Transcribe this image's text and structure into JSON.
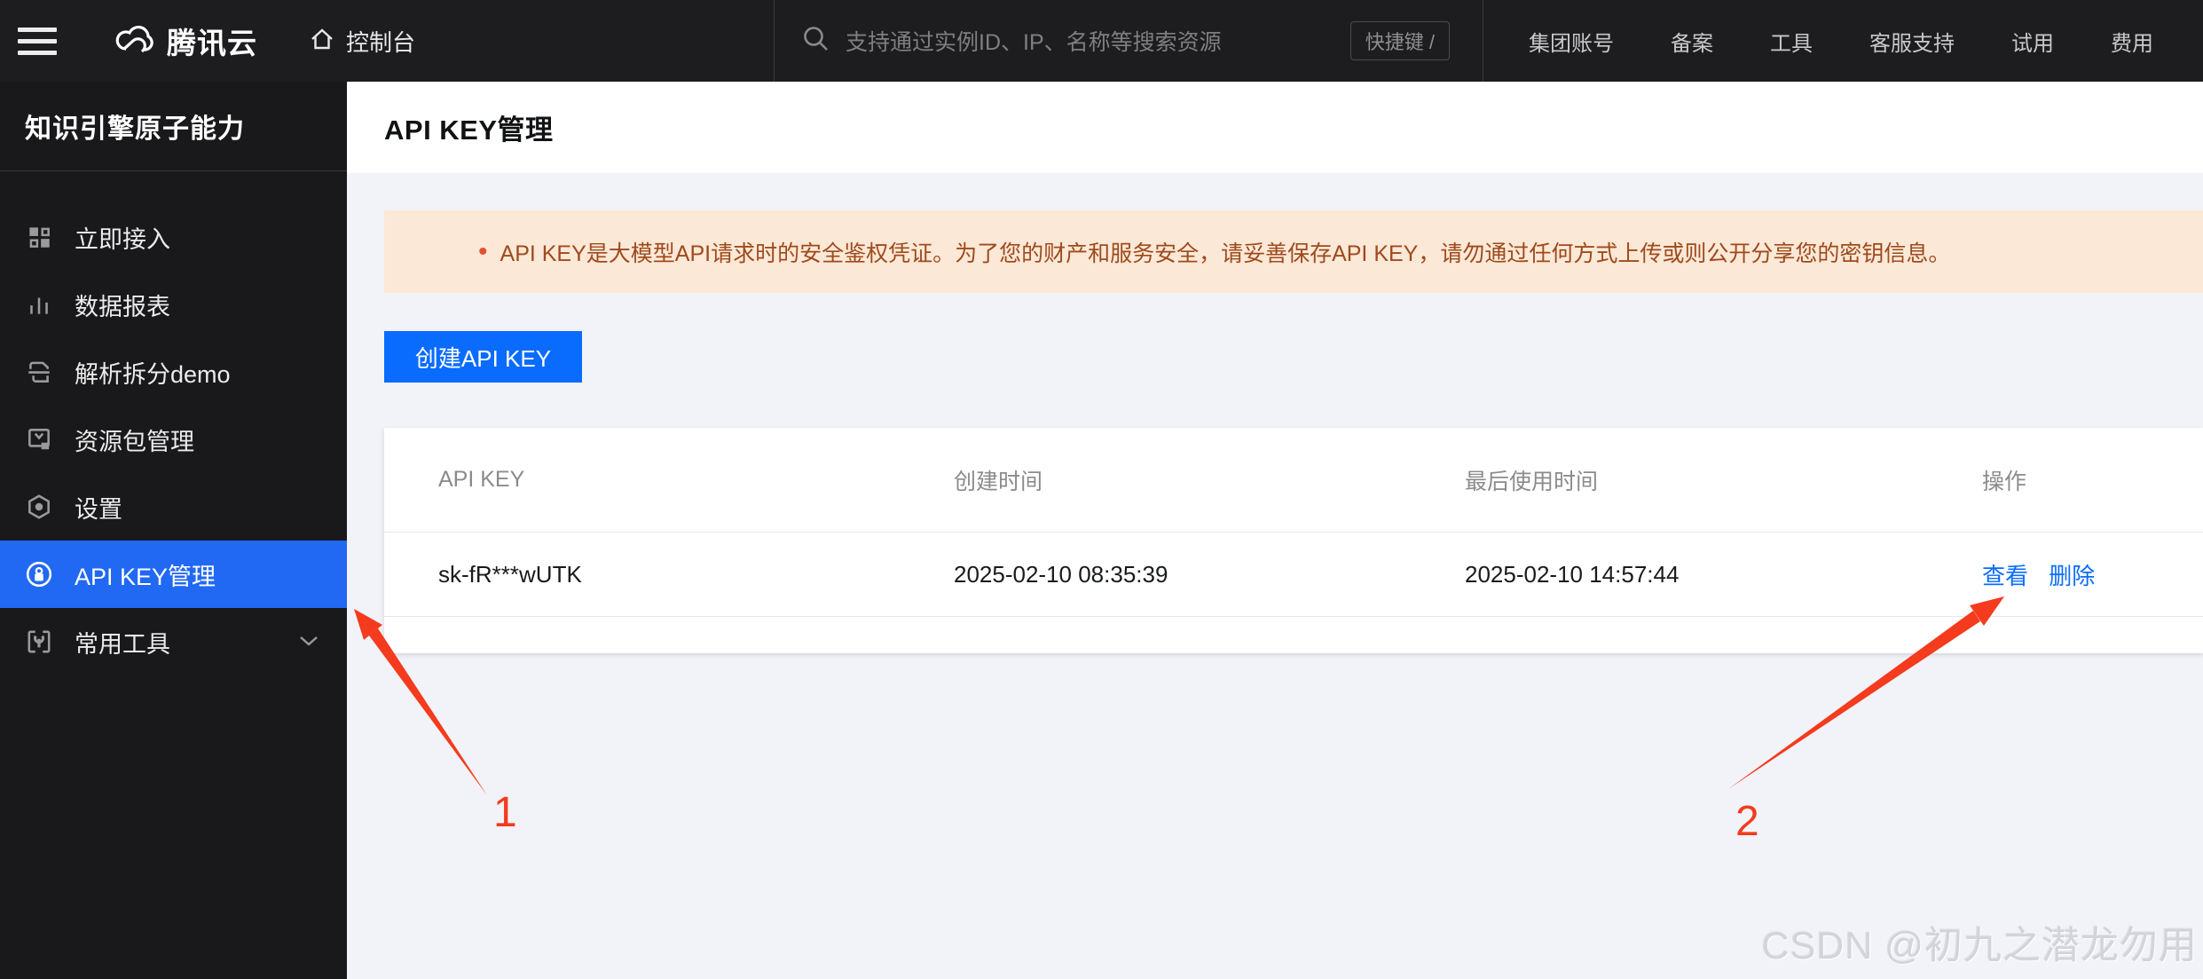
{
  "topbar": {
    "brand": "腾讯云",
    "console": "控制台",
    "search_placeholder": "支持通过实例ID、IP、名称等搜索资源",
    "shortcut_hint": "快捷键 /",
    "menu": [
      "集团账号",
      "备案",
      "工具",
      "客服支持",
      "试用",
      "费用"
    ]
  },
  "sidebar": {
    "title": "知识引擎原子能力",
    "items": [
      {
        "label": "立即接入",
        "icon": "grid-icon",
        "active": false
      },
      {
        "label": "数据报表",
        "icon": "bar-chart-icon",
        "active": false
      },
      {
        "label": "解析拆分demo",
        "icon": "document-split-icon",
        "active": false
      },
      {
        "label": "资源包管理",
        "icon": "resource-package-icon",
        "active": false
      },
      {
        "label": "设置",
        "icon": "gear-icon",
        "active": false
      },
      {
        "label": "API KEY管理",
        "icon": "key-icon",
        "active": true
      },
      {
        "label": "常用工具",
        "icon": "wrench-icon",
        "active": false,
        "chevron": "down"
      }
    ]
  },
  "page": {
    "title": "API KEY管理",
    "alert_bullet": "•",
    "alert_text": "API KEY是大模型API请求时的安全鉴权凭证。为了您的财产和服务安全，请妥善保存API KEY，请勿通过任何方式上传或则公开分享您的密钥信息。",
    "create_button": "创建API KEY"
  },
  "table": {
    "headers": [
      "API KEY",
      "创建时间",
      "最后使用时间",
      "操作"
    ],
    "rows": [
      {
        "api_key": "sk-fR***wUTK",
        "created_at": "2025-02-10 08:35:39",
        "last_used_at": "2025-02-10 14:57:44",
        "actions": [
          "查看",
          "删除"
        ]
      }
    ]
  },
  "annotations": {
    "label_1": "1",
    "label_2": "2",
    "arrow_color": "#f43b1e"
  },
  "watermark": "CSDN @初九之潜龙勿用",
  "colors": {
    "topbar_bg": "#1d1d1f",
    "sidebar_bg": "#19191b",
    "sidebar_active_bg": "#2169f2",
    "primary_button": "#0a6cff",
    "link": "#0a6cff",
    "alert_bg": "#fce8d7",
    "alert_text": "#9e4a1c",
    "content_bg": "#f2f3f8"
  }
}
